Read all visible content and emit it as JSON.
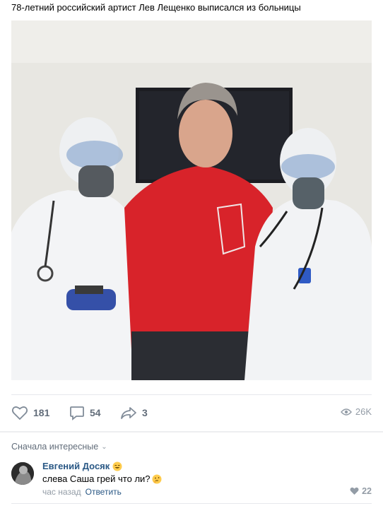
{
  "post": {
    "text": "78-летний российский артист Лев Лещенко выписался из больницы"
  },
  "actions": {
    "likes": "181",
    "comments": "54",
    "shares": "3",
    "views": "26K"
  },
  "comments": {
    "sort_label": "Сначала интересные",
    "items": [
      {
        "author": "Евгений Досяк",
        "text": "слева Саша грей что ли?",
        "time": "час назад",
        "reply_label": "Ответить",
        "likes": "22"
      }
    ]
  },
  "icons": {
    "like": "heart-icon",
    "comment": "comment-icon",
    "share": "share-icon",
    "views": "eye-icon"
  },
  "colors": {
    "link": "#2a5885",
    "muted": "#939ca6",
    "action": "#626d7a"
  }
}
